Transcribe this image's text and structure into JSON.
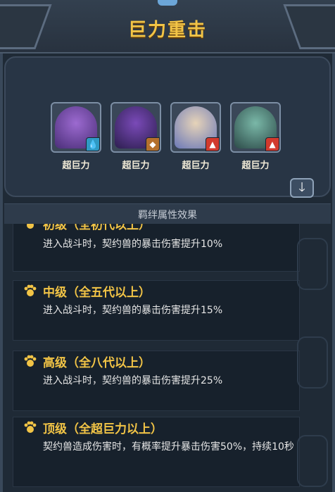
{
  "title": "巨力重击",
  "cards": [
    {
      "label": "超巨力",
      "element_icon": "water-icon",
      "color": "#2f9ac4"
    },
    {
      "label": "超巨力",
      "element_icon": "earth-icon",
      "color": "#b4702c"
    },
    {
      "label": "超巨力",
      "element_icon": "fire-icon",
      "color": "#d23a2e"
    },
    {
      "label": "超巨力",
      "element_icon": "fire-icon",
      "color": "#d23a2e"
    }
  ],
  "effects_header": "羁绊属性效果",
  "tiers": [
    {
      "title": "初级（全初代以上）",
      "desc": "进入战斗时，契约兽的暴击伤害提升10%"
    },
    {
      "title": "中级（全五代以上）",
      "desc": "进入战斗时，契约兽的暴击伤害提升15%"
    },
    {
      "title": "高级（全八代以上）",
      "desc": "进入战斗时，契约兽的暴击伤害提升25%"
    },
    {
      "title": "顶级（全超巨力以上）",
      "desc": "契约兽造成伤害时，有概率提升暴击伤害50%，持续10秒"
    }
  ],
  "arrow_icon": "arrow-down-icon",
  "accent_color": "#f2c446"
}
